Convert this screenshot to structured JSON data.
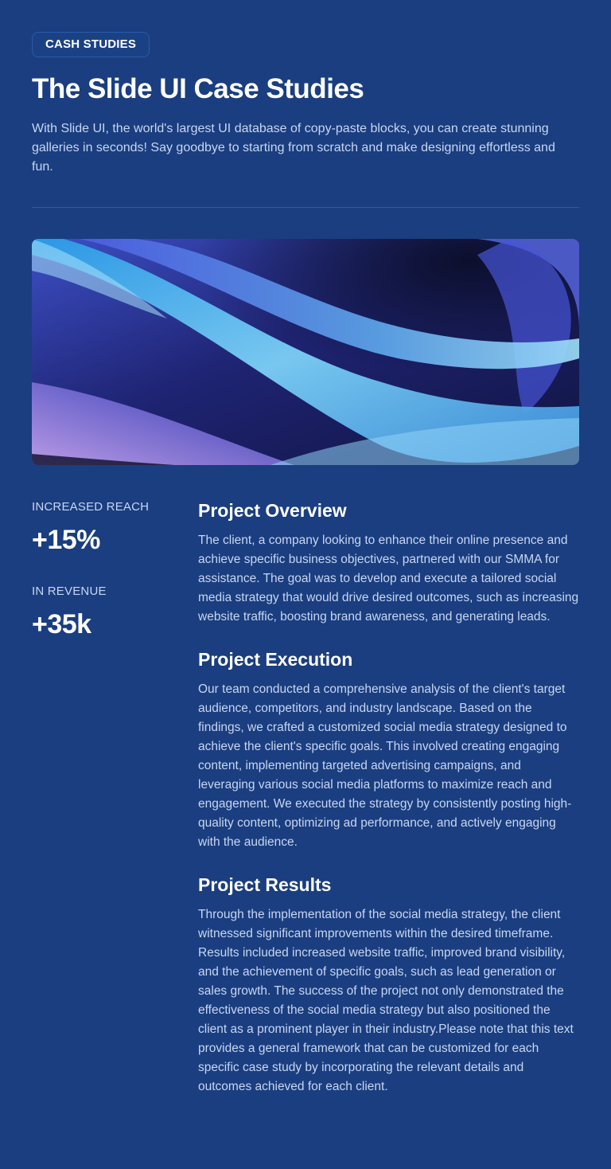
{
  "header": {
    "badge": "CASH STUDIES",
    "title": "The Slide UI Case Studies",
    "subtitle": "With Slide UI, the world's largest UI database of copy-paste blocks, you can create stunning galleries in seconds! Say goodbye to starting from scratch and make designing effortless and fun."
  },
  "stats": [
    {
      "label": "INCREASED REACH",
      "value": "+15%"
    },
    {
      "label": "IN REVENUE",
      "value": "+35k"
    }
  ],
  "sections": [
    {
      "title": "Project Overview",
      "body": "The client, a company looking to enhance their online presence and achieve specific business objectives, partnered with our SMMA for assistance. The goal was to develop and execute a tailored social media strategy that would drive desired outcomes, such as increasing website traffic, boosting brand awareness, and generating leads."
    },
    {
      "title": "Project Execution",
      "body": "Our team conducted a comprehensive analysis of the client's target audience, competitors, and industry landscape. Based on the findings, we crafted a customized social media strategy designed to achieve the client's specific goals. This involved creating engaging content, implementing targeted advertising campaigns, and leveraging various social media platforms to maximize reach and engagement. We executed the strategy by consistently posting high-quality content, optimizing ad performance, and actively engaging with the audience."
    },
    {
      "title": "Project Results",
      "body": "Through the implementation of the social media strategy, the client witnessed significant improvements within the desired timeframe. Results included increased website traffic, improved brand visibility, and the achievement of specific goals, such as lead generation or sales growth. The success of the project not only demonstrated the effectiveness of the social media strategy but also positioned the client as a prominent player in their industry.Please note that this text provides a general framework that can be customized for each specific case study by incorporating the relevant details and outcomes achieved for each client."
    }
  ],
  "colors": {
    "background": "#1a3e7f",
    "body_text": "#c8d6f2",
    "heading_text": "#ffffff",
    "divider": "#2f5aa5"
  }
}
